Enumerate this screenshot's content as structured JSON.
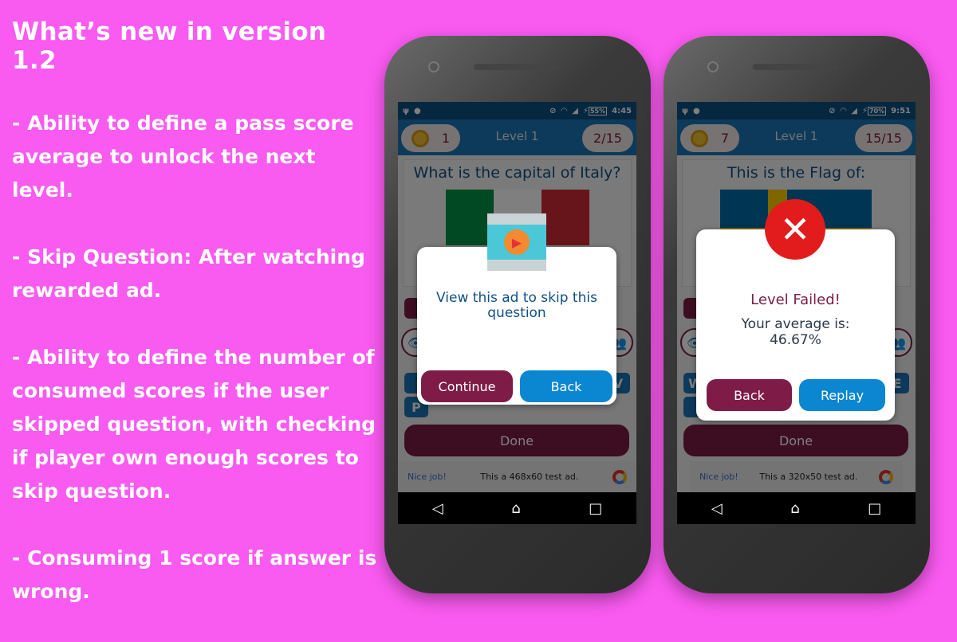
{
  "notes": {
    "title": "What’s new in version 1.2",
    "items": [
      "- Ability to define a pass score average to unlock the next level.",
      "- Skip Question: After watching rewarded ad.",
      "- Ability to define the number of consumed scores if the user skipped question, with checking if player own enough scores to skip question.",
      "- Consuming 1 score if answer is wrong."
    ]
  },
  "phones": [
    {
      "battery": "55%",
      "time": "4:45",
      "score": "1",
      "level": "Level 1",
      "progress": "2/15",
      "question": "What is the capital of Italy?",
      "tiles": [
        "",
        "V",
        "P"
      ],
      "done": "Done",
      "ad": {
        "nice": "Nice job!",
        "text": "This a 468x60 test ad."
      },
      "dialog": {
        "icon": "video-play-icon",
        "message": "View this ad to skip this question",
        "primary": "Continue",
        "secondary": "Back"
      }
    },
    {
      "battery": "70%",
      "time": "9:51",
      "score": "7",
      "level": "Level 1",
      "progress": "15/15",
      "question": "This is the Flag of:",
      "tiles": [
        "W",
        "E",
        ""
      ],
      "done": "Done",
      "ad": {
        "nice": "Nice job!",
        "text": "This a 320x50 test ad."
      },
      "dialog": {
        "icon": "error-x-icon",
        "title": "Level Failed!",
        "message": "Your average is:",
        "value": "46.67%",
        "primary": "Back",
        "secondary": "Replay"
      }
    }
  ],
  "colors": {
    "background": "#f95af0",
    "maroon": "#7e1c47",
    "blue": "#0b86d0",
    "header": "#1a74b5"
  }
}
